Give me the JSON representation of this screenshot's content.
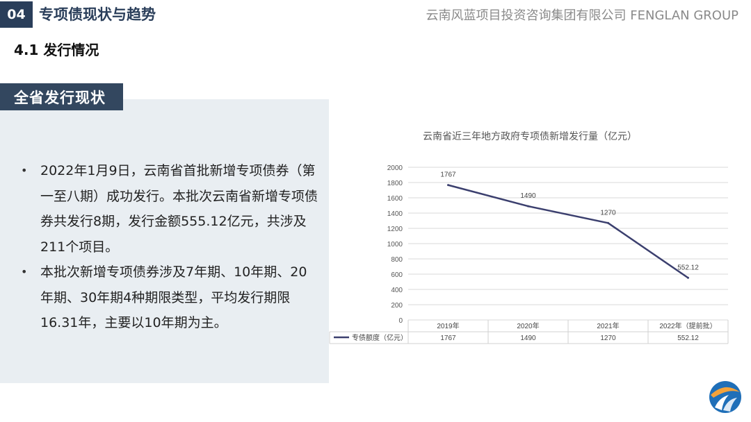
{
  "header": {
    "section_number": "04",
    "section_title": "专项债现状与趋势",
    "company": "云南风蓝项目投资咨询集团有限公司 FENGLAN GROUP"
  },
  "subtitle": "4.1 发行情况",
  "panel": {
    "tab_label": "全省发行现状",
    "bullets": [
      "2022年1月9日，云南省首批新增专项债券（第一至八期）成功发行。本批次云南省新增专项债券共发行8期，发行金额555.12亿元，共涉及211个项目。",
      "本批次新增专项债券涉及7年期、10年期、20年期、30年期4种期限类型，平均发行期限16.31年，主要以10年期为主。"
    ]
  },
  "chart_data": {
    "type": "line",
    "title": "云南省近三年地方政府专项债新增发行量（亿元）",
    "categories": [
      "2019年",
      "2020年",
      "2021年",
      "2022年（提前批）"
    ],
    "series": [
      {
        "name": "专债额度（亿元）",
        "values": [
          1767,
          1490,
          1270,
          552.12
        ],
        "labels": [
          "1767",
          "1490",
          "1270",
          "552.12"
        ],
        "color": "#3b3f6e"
      }
    ],
    "ylim": [
      0,
      2000
    ],
    "yticks": [
      0,
      200,
      400,
      600,
      800,
      1000,
      1200,
      1400,
      1600,
      1800,
      2000
    ],
    "grid": true,
    "data_table": true
  },
  "colors": {
    "accent": "#2a3e5a",
    "panel_bg": "#e9eef2",
    "line": "#3b3f6e"
  },
  "logo": {
    "icon": "fenglan-logo-icon"
  }
}
